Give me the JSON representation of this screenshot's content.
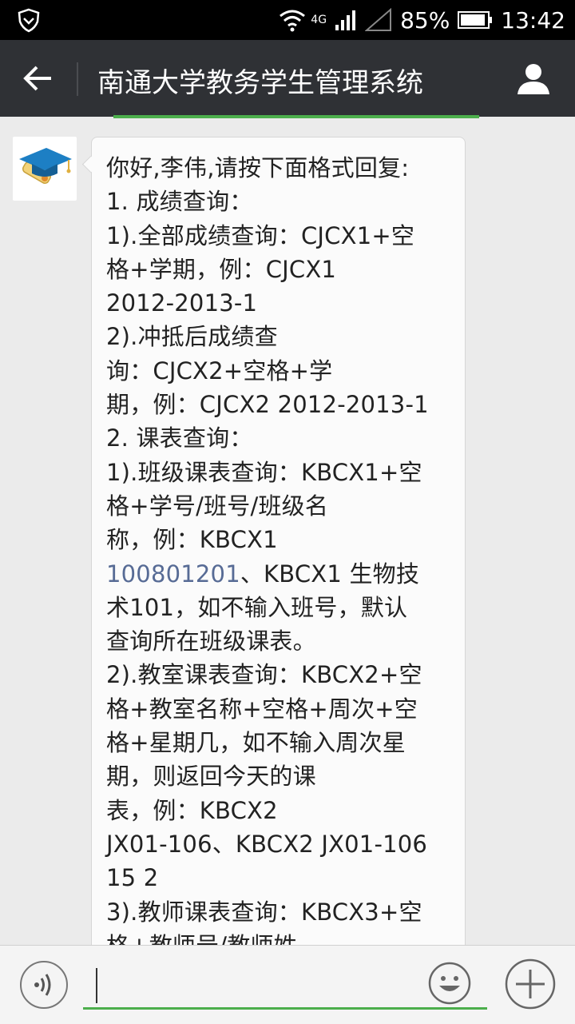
{
  "status_bar": {
    "network": "4G",
    "battery": "85%",
    "time": "13:42"
  },
  "header": {
    "title": "南通大学教务学生管理系统",
    "back_icon": "back-arrow-icon",
    "profile_icon": "person-icon",
    "bg_color": "#2f3135"
  },
  "chat": {
    "message_lines": [
      {
        "text": "你好,李伟,请按下面格式回复:"
      },
      {
        "text": "1. 成绩查询："
      },
      {
        "text": "1).全部成绩查询：CJCX1+空"
      },
      {
        "text": "格+学期，例：CJCX1"
      },
      {
        "text": "2012-2013-1"
      },
      {
        "text": "2).冲抵后成绩查"
      },
      {
        "text": "询：CJCX2+空格+学"
      },
      {
        "text": "期，例：CJCX2 2012-2013-1"
      },
      {
        "text": "2. 课表查询："
      },
      {
        "text": "1).班级课表查询：KBCX1+空"
      },
      {
        "text": "格+学号/班号/班级名"
      },
      {
        "text": "称，例：KBCX1"
      },
      {
        "link": "100801201",
        "text": "、KBCX1 生物技"
      },
      {
        "text": "术101，如不输入班号，默认"
      },
      {
        "text": "查询所在班级课表。"
      },
      {
        "text": "2).教室课表查询：KBCX2+空"
      },
      {
        "text": "格+教室名称+空格+周次+空"
      },
      {
        "text": "格+星期几，如不输入周次星"
      },
      {
        "text": "期，则返回今天的课"
      },
      {
        "text": "表，例：KBCX2"
      },
      {
        "text": "JX01-106、KBCX2 JX01-106"
      },
      {
        "text": "15 2"
      },
      {
        "text": "3).教师课表查询：KBCX3+空"
      },
      {
        "text": "格+教师号/教师姓"
      }
    ],
    "link_color": "#576b95"
  },
  "input_bar": {
    "placeholder": "",
    "voice_icon": "voice-icon",
    "emoji_icon": "emoji-icon",
    "plus_icon": "plus-icon",
    "accent": "#4cae4c"
  }
}
